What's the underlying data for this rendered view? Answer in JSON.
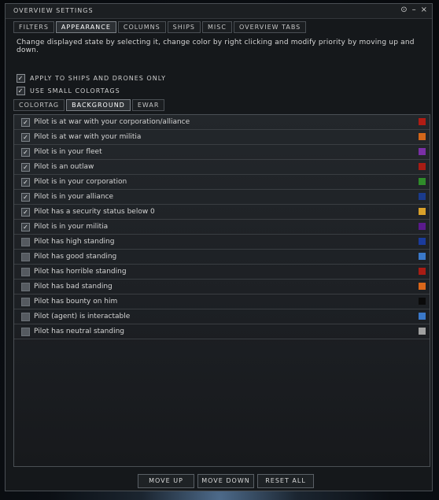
{
  "window": {
    "title": "OVERVIEW SETTINGS",
    "controls": {
      "settings": "⊙",
      "minimize": "–",
      "close": "×"
    }
  },
  "top_tabs": [
    "FILTERS",
    "APPEARANCE",
    "COLUMNS",
    "SHIPS",
    "MISC",
    "OVERVIEW TABS"
  ],
  "description": "Change displayed state by selecting it, change color by right clicking and modify priority by moving up and down.",
  "options": [
    {
      "label": "APPLY TO SHIPS AND DRONES ONLY",
      "checked": true
    },
    {
      "label": "USE SMALL COLORTAGS",
      "checked": true
    }
  ],
  "sub_tabs": [
    "COLORTAG",
    "BACKGROUND",
    "EWAR"
  ],
  "states": [
    {
      "label": "Pilot is at war with your corporation/alliance",
      "checked": true,
      "color": "#b01c14"
    },
    {
      "label": "Pilot is at war with your militia",
      "checked": true,
      "color": "#d2661a"
    },
    {
      "label": "Pilot is in your fleet",
      "checked": true,
      "color": "#7a2fa6"
    },
    {
      "label": "Pilot is an outlaw",
      "checked": true,
      "color": "#a81c14"
    },
    {
      "label": "Pilot is in your corporation",
      "checked": true,
      "color": "#2f8c2a"
    },
    {
      "label": "Pilot is in your alliance",
      "checked": true,
      "color": "#1a3b8c"
    },
    {
      "label": "Pilot has a security status below 0",
      "checked": true,
      "color": "#d9a12a"
    },
    {
      "label": "Pilot is in your militia",
      "checked": true,
      "color": "#5a1a8c"
    },
    {
      "label": "Pilot has high standing",
      "checked": false,
      "color": "#1a3b9c"
    },
    {
      "label": "Pilot has good standing",
      "checked": false,
      "color": "#3a78c8"
    },
    {
      "label": "Pilot has horrible standing",
      "checked": false,
      "color": "#a81c14"
    },
    {
      "label": "Pilot has bad standing",
      "checked": false,
      "color": "#d9661a"
    },
    {
      "label": "Pilot has bounty on him",
      "checked": false,
      "color": "#0a0a0a"
    },
    {
      "label": "Pilot (agent) is interactable",
      "checked": false,
      "color": "#3a78c8"
    },
    {
      "label": "Pilot has neutral standing",
      "checked": false,
      "color": "#a0a0a0"
    }
  ],
  "buttons": {
    "move_up": "MOVE UP",
    "move_down": "MOVE DOWN",
    "reset_all": "RESET ALL"
  }
}
